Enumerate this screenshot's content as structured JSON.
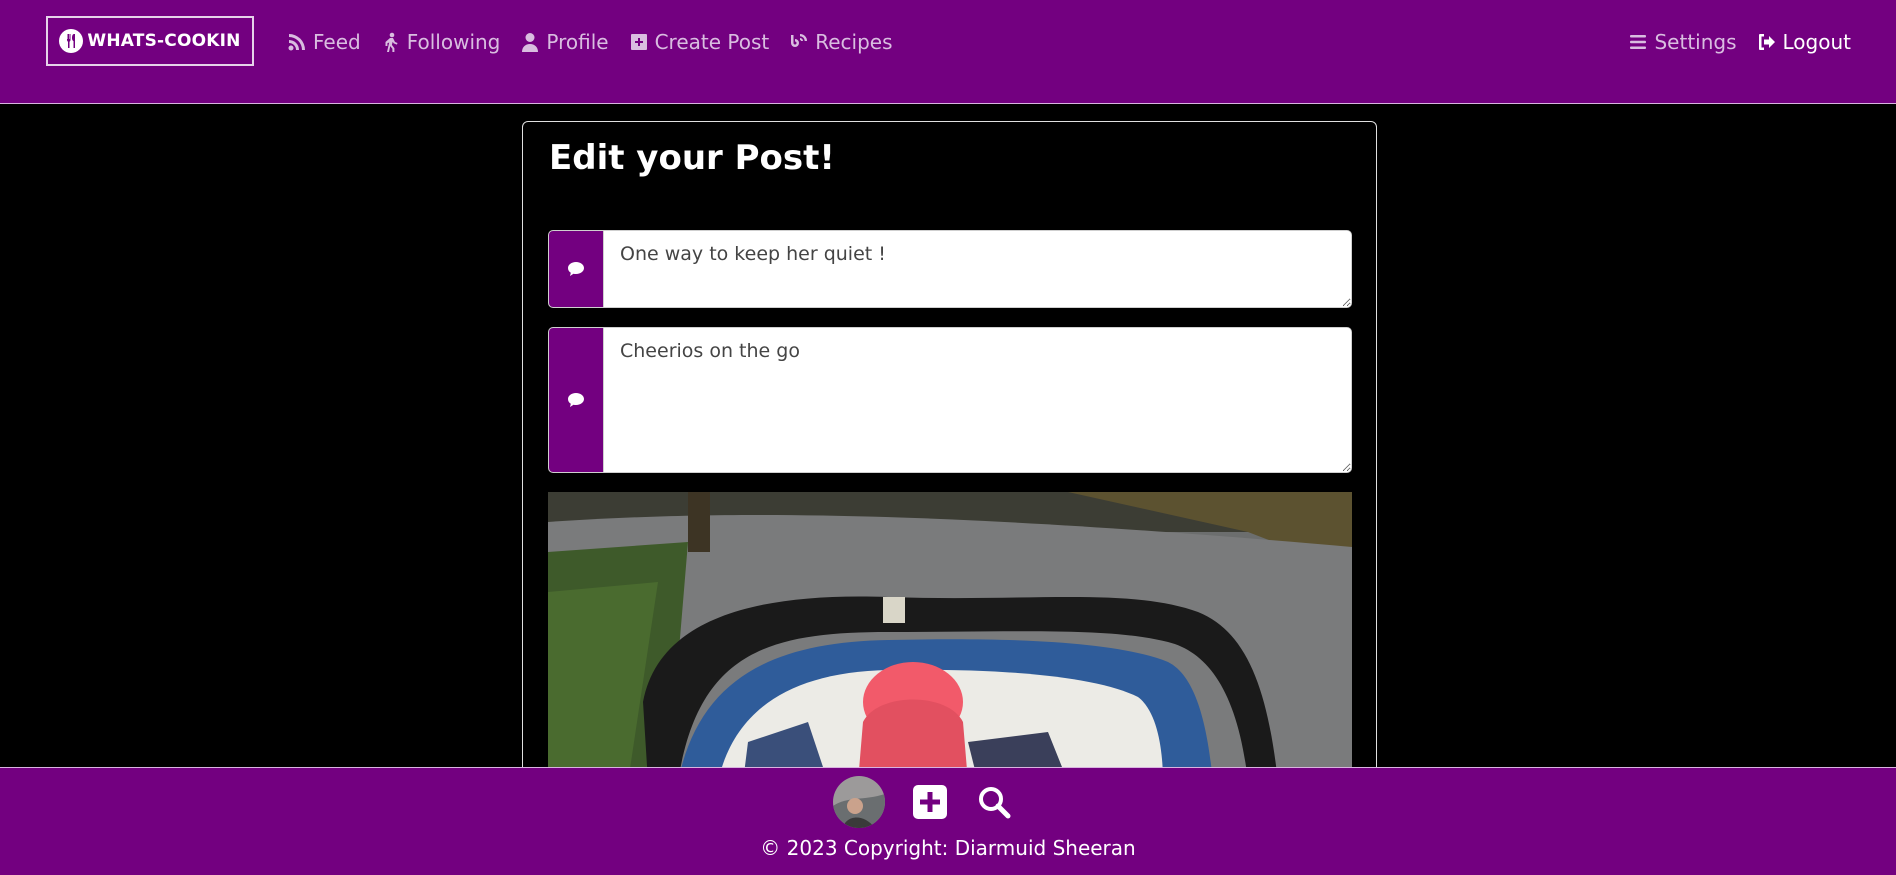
{
  "brand": {
    "label": "WHATS-COOKIN"
  },
  "nav": {
    "left": [
      {
        "label": "Feed",
        "icon": "rss-icon"
      },
      {
        "label": "Following",
        "icon": "walking-icon"
      },
      {
        "label": "Profile",
        "icon": "user-icon"
      },
      {
        "label": "Create Post",
        "icon": "plus-square-icon"
      },
      {
        "label": "Recipes",
        "icon": "blog-icon"
      }
    ],
    "right": [
      {
        "label": "Settings",
        "icon": "bars-icon"
      },
      {
        "label": "Logout",
        "icon": "sign-out-icon"
      }
    ]
  },
  "form": {
    "heading": "Edit your Post!",
    "title_value": "One way to keep her quiet !",
    "body_value": "Cheerios on the go"
  },
  "footer": {
    "copyright": "© 2023 Copyright: Diarmuid Sheeran"
  },
  "colors": {
    "brand_purple": "#730080",
    "nav_link": "#d9bde0",
    "background": "#000000"
  }
}
